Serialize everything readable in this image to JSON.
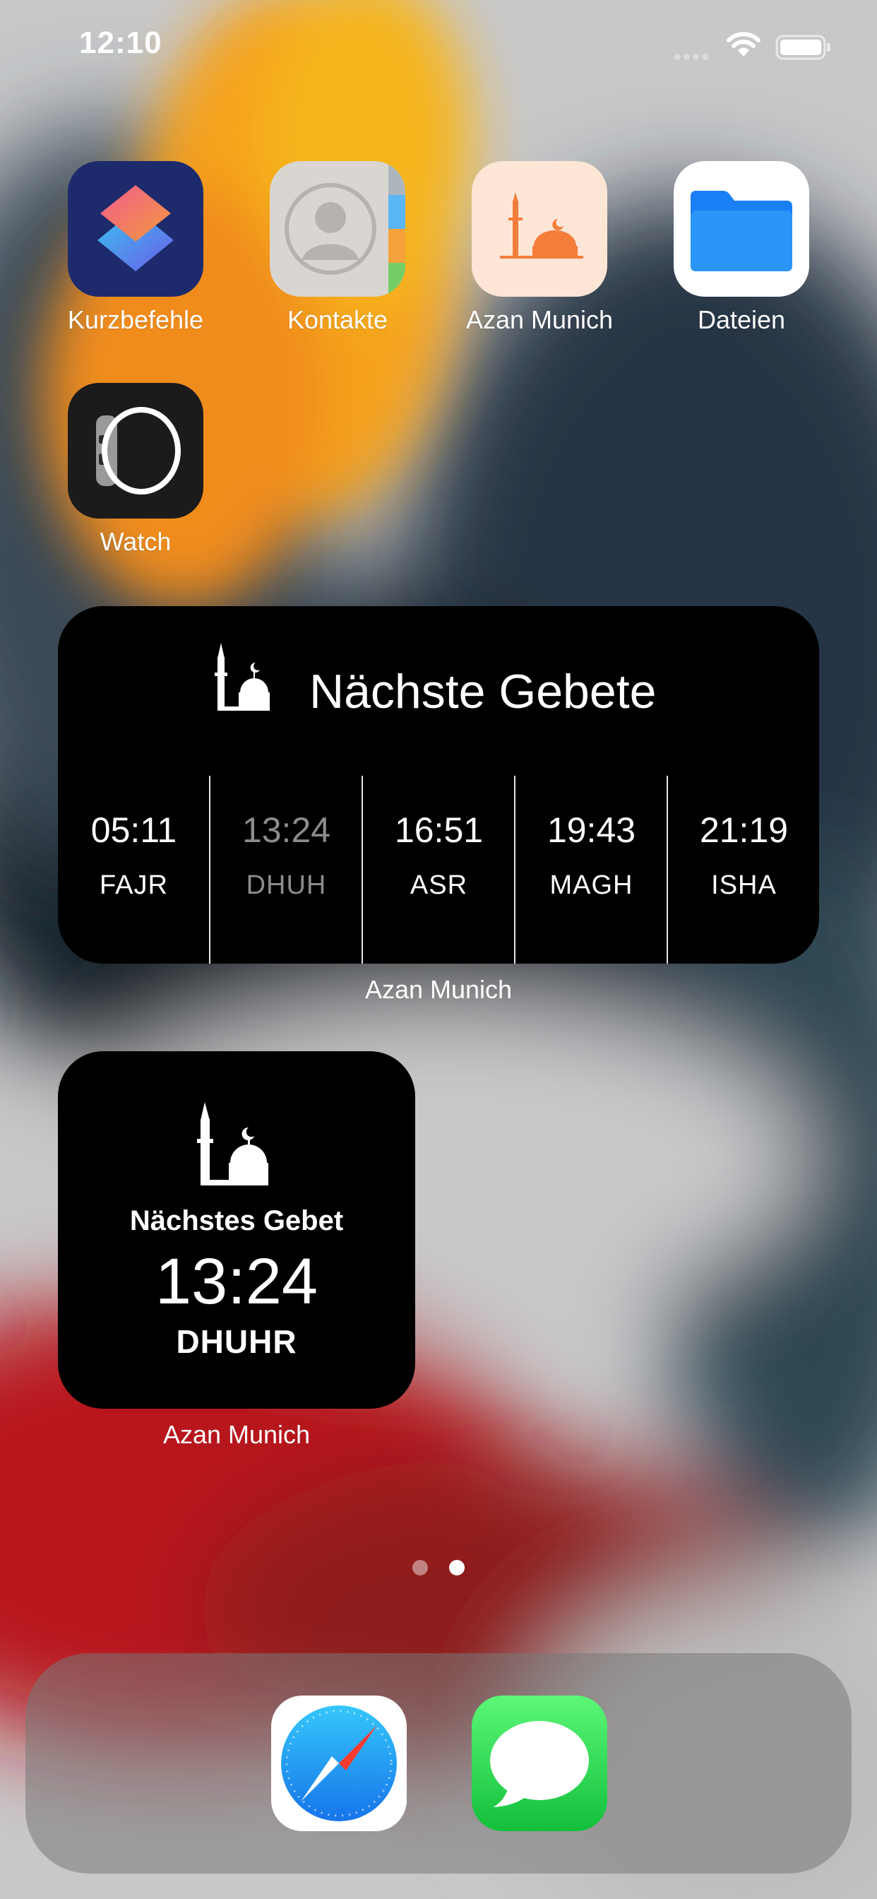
{
  "status_bar": {
    "time": "12:10",
    "icons": [
      "signal-icon",
      "wifi-icon",
      "battery-icon"
    ]
  },
  "apps": [
    {
      "label": "Kurzbefehle",
      "icon": "shortcuts-icon"
    },
    {
      "label": "Kontakte",
      "icon": "contacts-icon"
    },
    {
      "label": "Azan Munich",
      "icon": "azan-munich-icon"
    },
    {
      "label": "Dateien",
      "icon": "files-folder-icon"
    },
    {
      "label": "Watch",
      "icon": "watch-icon"
    }
  ],
  "widget_medium": {
    "title": "Nächste Gebete",
    "icon": "mosque-icon",
    "prayers": [
      {
        "time": "05:11",
        "name": "FAJR",
        "dimmed": false
      },
      {
        "time": "13:24",
        "name": "DHUH",
        "dimmed": true
      },
      {
        "time": "16:51",
        "name": "ASR",
        "dimmed": false
      },
      {
        "time": "19:43",
        "name": "MAGH",
        "dimmed": false
      },
      {
        "time": "21:19",
        "name": "ISHA",
        "dimmed": false
      }
    ],
    "caption": "Azan Munich"
  },
  "widget_small": {
    "title": "Nächstes Gebet",
    "time": "13:24",
    "name": "DHUHR",
    "icon": "mosque-icon",
    "caption": "Azan Munich"
  },
  "page_indicator": {
    "pages": 2,
    "current": 2
  },
  "dock": {
    "apps": [
      {
        "icon": "safari-icon"
      },
      {
        "icon": "messages-icon"
      }
    ]
  },
  "colors": {
    "widget_bg": "#000000",
    "dim_text": "#8c8c8c",
    "azan_tile_bg": "#fde6d6",
    "azan_accent": "#f47d3a"
  }
}
